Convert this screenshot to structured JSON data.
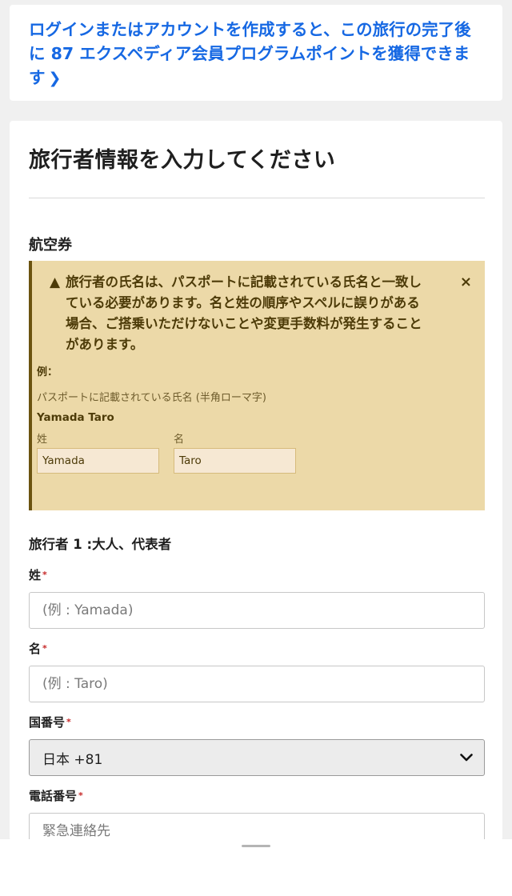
{
  "promo": {
    "text": "ログインまたはアカウントを作成すると、この旅行の完了後に 87 エクスペディア会員プログラムポイントを獲得できます",
    "icon": "chevron-right-icon"
  },
  "form": {
    "title": "旅行者情報を入力してください",
    "section_title": "航空券",
    "alert": {
      "message": "旅行者の氏名は、パスポートに記載されている氏名と一致している必要があります。名と姓の順序やスペルに誤りがある場合、ご搭乗いただけないことや変更手数料が発生することがあります。",
      "close_symbol": "×",
      "warning_symbol": "▲",
      "example_label": "例：",
      "passport_note": "パスポートに記載されている氏名 (半角ローマ字)",
      "example_name": "Yamada Taro",
      "last_name_label": "姓",
      "last_name_value": "Yamada",
      "first_name_label": "名",
      "first_name_value": "Taro"
    },
    "traveler_heading": "旅行者 1 :大人、代表者",
    "required_mark": "*",
    "last_name": {
      "label": "姓",
      "placeholder": "(例 : Yamada)"
    },
    "first_name": {
      "label": "名",
      "placeholder": "(例 : Taro)"
    },
    "country_code": {
      "label": "国番号",
      "selected": "日本 +81"
    },
    "phone": {
      "label": "電話番号",
      "placeholder": "緊急連絡先"
    }
  },
  "colors": {
    "link": "#1668e3",
    "alert_bg": "#ecd9a8",
    "alert_text": "#4d3b08",
    "required": "#c62828"
  }
}
